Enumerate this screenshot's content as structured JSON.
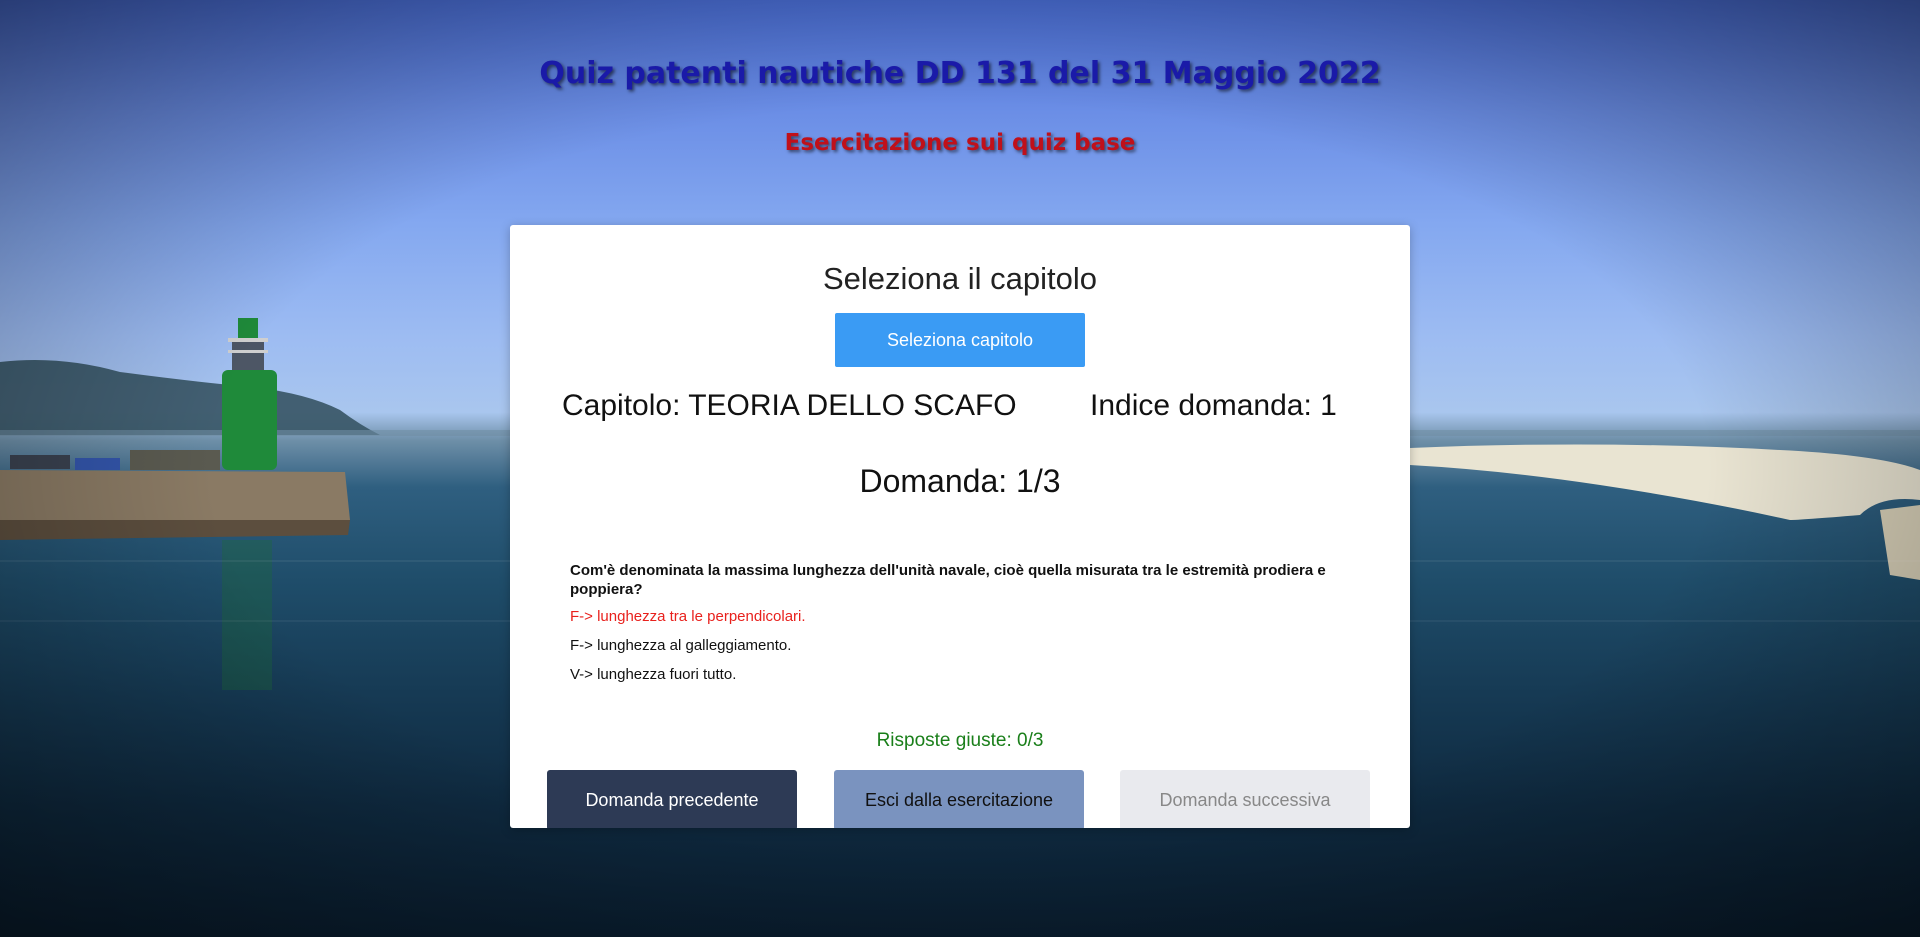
{
  "header": {
    "title": "Quiz patenti nautiche DD 131 del 31 Maggio 2022",
    "subtitle": "Esercitazione sui quiz base"
  },
  "card": {
    "heading": "Seleziona il capitolo",
    "select_button_label": "Seleziona capitolo",
    "chapter_label": "Capitolo: TEORIA DELLO SCAFO",
    "index_label": "Indice domanda: 1",
    "question_counter": "Domanda: 1/3",
    "question": {
      "text": "Com'è denominata la massima lunghezza dell'unità navale, cioè quella misurata tra le estremità prodiera e poppiera?",
      "answers": [
        {
          "label": "F-> lunghezza tra le perpendicolari.",
          "state": "wrong-selected"
        },
        {
          "label": "F-> lunghezza al galleggiamento.",
          "state": "normal"
        },
        {
          "label": "V-> lunghezza fuori tutto.",
          "state": "normal"
        }
      ]
    },
    "score_label": "Risposte giuste: 0/3",
    "buttons": {
      "prev": "Domanda precedente",
      "exit": "Esci dalla esercitazione",
      "next": "Domanda successiva"
    }
  },
  "colors": {
    "title": "#1a1aa8",
    "subtitle": "#c0101a",
    "select_button": "#3a9bf4",
    "wrong_answer": "#e8211d",
    "score": "#1a7f1a",
    "prev_button": "#2d3a55",
    "exit_button": "#7a93bf",
    "next_button_disabled": "#e9eaee"
  }
}
